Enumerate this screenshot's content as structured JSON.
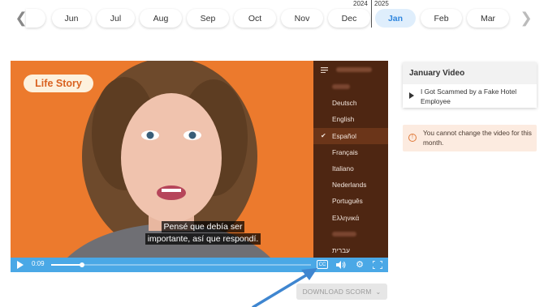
{
  "timeline": {
    "months": [
      "Jun",
      "Jul",
      "Aug",
      "Sep",
      "Oct",
      "Nov",
      "Dec",
      "Jan",
      "Feb",
      "Mar"
    ],
    "active_month": "Jan",
    "year_left": "2024",
    "year_right": "2025",
    "prev_icon": "chevron-left-icon",
    "next_icon": "chevron-right-icon"
  },
  "video": {
    "brand": "Life Story",
    "subtitle_line1": "Pensé que debía ser",
    "subtitle_line2": "importante, así que respondí.",
    "time": "0:09",
    "progress": 0.12,
    "cc_label": "CC",
    "accent_color": "#ec7a2d",
    "controls_color": "#4aa8e6"
  },
  "language_menu": {
    "items": [
      "Deutsch",
      "English",
      "Español",
      "Français",
      "Italiano",
      "Nederlands",
      "Português",
      "Ελληνικά",
      "עברית"
    ],
    "selected": "Español"
  },
  "download": {
    "label": "DOWNLOAD SCORM"
  },
  "panel": {
    "title": "January Video",
    "item_title": "I Got Scammed by a Fake Hotel Employee"
  },
  "notice": {
    "text": "You cannot change the video for this month."
  }
}
